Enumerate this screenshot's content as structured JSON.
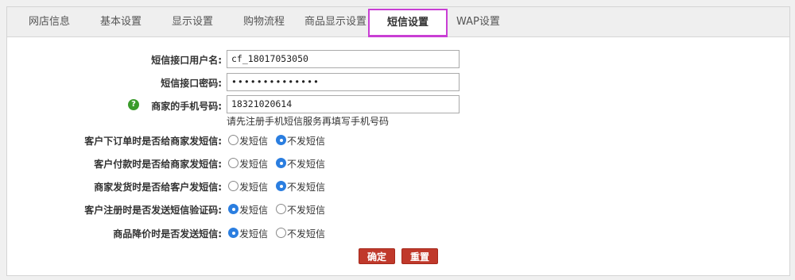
{
  "tabs": [
    {
      "label": "网店信息"
    },
    {
      "label": "基本设置"
    },
    {
      "label": "显示设置"
    },
    {
      "label": "购物流程"
    },
    {
      "label": "商品显示设置"
    },
    {
      "label": "短信设置"
    },
    {
      "label": "WAP设置"
    }
  ],
  "active_tab": "短信设置",
  "form": {
    "sms_user_label": "短信接口用户名:",
    "sms_user_value": "cf_18017053050",
    "sms_pass_label": "短信接口密码:",
    "sms_pass_value": "••••••••••••••",
    "merchant_phone_label": "商家的手机号码:",
    "merchant_phone_value": "18321020614",
    "merchant_phone_hint": "请先注册手机短信服务再填写手机号码",
    "help_icon_glyph": "?",
    "options": [
      {
        "label": "客户下订单时是否给商家发短信:",
        "send": "发短信",
        "nosend": "不发短信",
        "selected": "nosend"
      },
      {
        "label": "客户付款时是否给商家发短信:",
        "send": "发短信",
        "nosend": "不发短信",
        "selected": "nosend"
      },
      {
        "label": "商家发货时是否给客户发短信:",
        "send": "发短信",
        "nosend": "不发短信",
        "selected": "nosend"
      },
      {
        "label": "客户注册时是否发送短信验证码:",
        "send": "发短信",
        "nosend": "不发短信",
        "selected": "send"
      },
      {
        "label": "商品降价时是否发送短信:",
        "send": "发短信",
        "nosend": "不发短信",
        "selected": "send"
      }
    ]
  },
  "buttons": {
    "confirm": "确定",
    "reset": "重置"
  },
  "colors": {
    "accent_button": "#c0392b",
    "tab_highlight": "#c93ed4",
    "radio_selected": "#2b7ee0",
    "help_icon": "#3a9b2b"
  }
}
